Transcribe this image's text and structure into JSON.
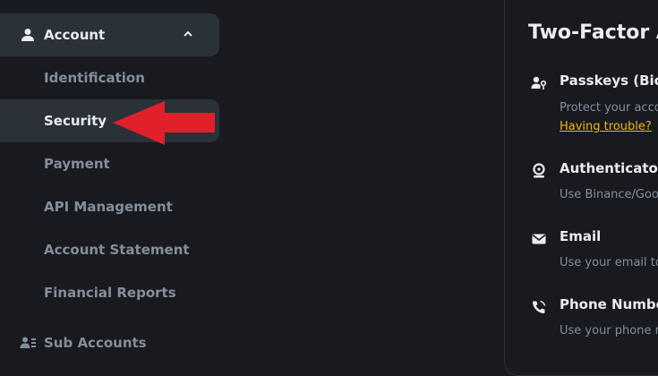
{
  "sidebar": {
    "section": {
      "label": "Account",
      "icon": "user-icon",
      "expanded_icon": "chevron-up-icon"
    },
    "items": [
      {
        "label": "Identification"
      },
      {
        "label": "Security"
      },
      {
        "label": "Payment"
      },
      {
        "label": "API Management"
      },
      {
        "label": "Account Statement"
      },
      {
        "label": "Financial Reports"
      }
    ],
    "sub_accounts": {
      "label": "Sub Accounts",
      "icon": "sub-accounts-icon"
    }
  },
  "annotation": {
    "arrow_color": "#e0202a"
  },
  "panel": {
    "title": "Two-Factor A",
    "methods": [
      {
        "title": "Passkeys (Biom",
        "desc": "Protect your acco",
        "link": "Having trouble?",
        "icon": "passkey-icon"
      },
      {
        "title": "Authenticator A",
        "desc": "Use Binance/Goog",
        "icon": "authenticator-icon"
      },
      {
        "title": "Email",
        "desc": "Use your email to",
        "icon": "email-icon"
      },
      {
        "title": "Phone Number",
        "desc": "Use your phone n",
        "icon": "phone-icon"
      }
    ]
  },
  "colors": {
    "background": "#181a20",
    "active_bg": "#2b3139",
    "link": "#f0b90b",
    "text": "#eaecef",
    "muted": "#848e9c"
  }
}
